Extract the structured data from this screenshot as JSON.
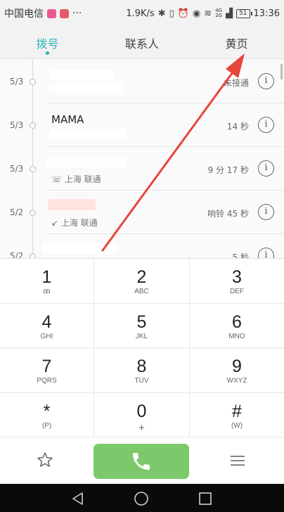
{
  "status_bar": {
    "carrier": "中国电信",
    "more": "···",
    "speed": "1.9K/s",
    "net_top": "4G",
    "net_bottom": "2G",
    "battery": "51",
    "time": "13:36"
  },
  "tabs": [
    {
      "label": "拨号",
      "active": true
    },
    {
      "label": "联系人",
      "active": false
    },
    {
      "label": "黄页",
      "active": false
    }
  ],
  "call_log": [
    {
      "date": "5/3",
      "name": "",
      "subtitle": "",
      "duration": "未接通",
      "missed": false
    },
    {
      "date": "5/3",
      "name": "MAMA",
      "subtitle": "",
      "duration": "14 秒",
      "missed": false
    },
    {
      "date": "5/3",
      "name": "",
      "subtitle": "上海 联通",
      "duration": "9 分 17 秒",
      "missed": false
    },
    {
      "date": "5/2",
      "name": "",
      "subtitle": "上海 联通",
      "duration": "响铃 45 秒",
      "missed": true
    },
    {
      "date": "5/2",
      "name": "",
      "subtitle": "",
      "duration": "5 秒",
      "missed": false
    }
  ],
  "keypad": [
    {
      "digit": "1",
      "letters": "ꝏ"
    },
    {
      "digit": "2",
      "letters": "ABC"
    },
    {
      "digit": "3",
      "letters": "DEF"
    },
    {
      "digit": "4",
      "letters": "GHI"
    },
    {
      "digit": "5",
      "letters": "JKL"
    },
    {
      "digit": "6",
      "letters": "MNO"
    },
    {
      "digit": "7",
      "letters": "PQRS"
    },
    {
      "digit": "8",
      "letters": "TUV"
    },
    {
      "digit": "9",
      "letters": "WXYZ"
    },
    {
      "digit": "*",
      "letters": "(P)"
    },
    {
      "digit": "0",
      "letters": "+"
    },
    {
      "digit": "#",
      "letters": "(W)"
    }
  ],
  "icons": {
    "favorites": "star-icon",
    "call": "phone-icon",
    "menu": "menu-icon",
    "back": "back-triangle-icon",
    "home": "home-circle-icon",
    "recents": "recents-square-icon"
  },
  "colors": {
    "accent": "#2bb3c0",
    "call_button": "#7cc96b",
    "missed": "#e84c3d",
    "annotation_arrow": "#e8453c"
  }
}
